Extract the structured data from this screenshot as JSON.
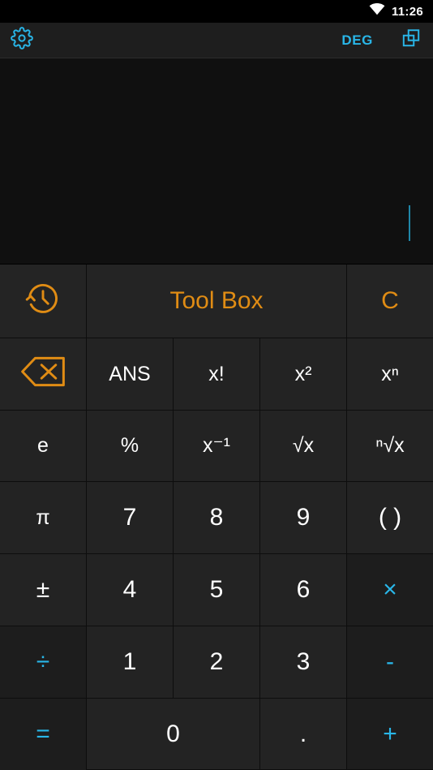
{
  "status_bar": {
    "time": "11:26",
    "wifi_icon": "wifi-icon"
  },
  "action_bar": {
    "settings_icon": "gear-icon",
    "angle_mode": "DEG",
    "copy_icon": "copy-windows-icon"
  },
  "display": {
    "expression": "",
    "caret_visible": true,
    "caret_color": "#1f86a8"
  },
  "keypad": {
    "tool_row": {
      "history_icon": "history-clock-icon",
      "toolbox_label": "Tool Box",
      "clear_label": "C",
      "backspace_icon": "backspace-icon"
    },
    "rows": [
      [
        {
          "label": "ANS",
          "style": "func"
        },
        {
          "label": "x!",
          "style": "func"
        },
        {
          "label": "x²",
          "style": "func"
        },
        {
          "label": "xⁿ",
          "style": "func"
        },
        {
          "label": "e",
          "style": "func"
        }
      ],
      [
        {
          "label": "%",
          "style": "func"
        },
        {
          "label": "x⁻¹",
          "style": "func"
        },
        {
          "label": "√x",
          "style": "func"
        },
        {
          "label": "ⁿ√x",
          "style": "func"
        },
        {
          "label": "π",
          "style": "func"
        }
      ],
      [
        {
          "label": "7",
          "style": "num"
        },
        {
          "label": "8",
          "style": "num"
        },
        {
          "label": "9",
          "style": "num"
        },
        {
          "label": "( )",
          "style": "num"
        },
        {
          "label": "±",
          "style": "num"
        }
      ],
      [
        {
          "label": "4",
          "style": "num"
        },
        {
          "label": "5",
          "style": "num"
        },
        {
          "label": "6",
          "style": "num"
        },
        {
          "label": "×",
          "style": "op"
        },
        {
          "label": "÷",
          "style": "op"
        }
      ],
      [
        {
          "label": "1",
          "style": "num"
        },
        {
          "label": "2",
          "style": "num"
        },
        {
          "label": "3",
          "style": "num"
        },
        {
          "label": "-",
          "style": "op"
        },
        {
          "label": "=",
          "style": "op"
        }
      ],
      [
        {
          "label": "0",
          "style": "num"
        },
        {
          "label": ".",
          "style": "num"
        },
        {
          "label": "+",
          "style": "op"
        }
      ]
    ]
  },
  "colors": {
    "accent_cyan": "#29b6e8",
    "accent_orange": "#e08c14",
    "key_bg": "#232323",
    "op_key_bg": "#1d1d1d",
    "display_bg": "#101010",
    "action_bar_bg": "#1e1e1e",
    "status_bar_bg": "#000000",
    "text_white": "#ffffff"
  }
}
